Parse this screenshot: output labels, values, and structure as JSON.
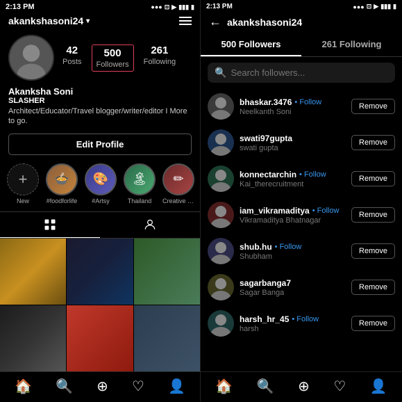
{
  "left": {
    "statusBar": {
      "time": "2:13 PM",
      "icons": "●●● ⬛ ⬛ ▮▮▮ 🔋"
    },
    "header": {
      "username": "akankshasoni24",
      "chevron": "▾"
    },
    "stats": {
      "posts": {
        "num": "42",
        "label": "Posts"
      },
      "followers": {
        "num": "500",
        "label": "Followers"
      },
      "following": {
        "num": "261",
        "label": "Following"
      }
    },
    "profileName": "Akanksha Soni",
    "profileTag": "SLASHER",
    "profileBio": "Architect/Educator/Travel blogger/writer/editor I More to go.",
    "editProfileLabel": "Edit Profile",
    "stories": [
      {
        "label": "New",
        "isAdd": true
      },
      {
        "label": "#foodforlife",
        "emoji": "🍲"
      },
      {
        "label": "#Artsy",
        "emoji": "🎨"
      },
      {
        "label": "Thailand",
        "emoji": "🏝"
      },
      {
        "label": "Creative W...",
        "emoji": "✏"
      }
    ],
    "tabs": {
      "grid": "grid",
      "person": "person"
    },
    "bottomNav": [
      "🏠",
      "🔍",
      "⊕",
      "♡",
      "👤"
    ]
  },
  "right": {
    "statusBar": {
      "time": "2:13 PM"
    },
    "header": {
      "backArrow": "←",
      "username": "akankshasoni24"
    },
    "tabs": {
      "followers": "500 Followers",
      "following": "261 Following"
    },
    "search": {
      "placeholder": "Search followers..."
    },
    "followers": [
      {
        "username": "bhaskar.3476",
        "followLabel": "• Follow",
        "realname": "Neelkanth Soni",
        "removeLabel": "Remove",
        "avatarClass": "av1",
        "emoji": "👤"
      },
      {
        "username": "swati97gupta",
        "followLabel": "",
        "realname": "swati gupta",
        "removeLabel": "Remove",
        "avatarClass": "av2",
        "emoji": "👤"
      },
      {
        "username": "konnectarchin",
        "followLabel": "• Follow",
        "realname": "Kai_therecruitment",
        "removeLabel": "Remove",
        "avatarClass": "av3",
        "emoji": "👤"
      },
      {
        "username": "iam_vikramaditya",
        "followLabel": "• Follow",
        "realname": "Vikramaditya Bhatnagar",
        "removeLabel": "Remove",
        "avatarClass": "av4",
        "emoji": "👤"
      },
      {
        "username": "shub.hu",
        "followLabel": "• Follow",
        "realname": "Shubham",
        "removeLabel": "Remove",
        "avatarClass": "av5",
        "emoji": "👤"
      },
      {
        "username": "sagarbanga7",
        "followLabel": "",
        "realname": "Sagar Banga",
        "removeLabel": "Remove",
        "avatarClass": "av6",
        "emoji": "👤"
      },
      {
        "username": "harsh_hr_45",
        "followLabel": "• Follow",
        "realname": "harsh",
        "removeLabel": "Remove",
        "avatarClass": "av7",
        "emoji": "👤"
      }
    ],
    "bottomNav": [
      "🏠",
      "🔍",
      "⊕",
      "♡",
      "👤"
    ]
  }
}
